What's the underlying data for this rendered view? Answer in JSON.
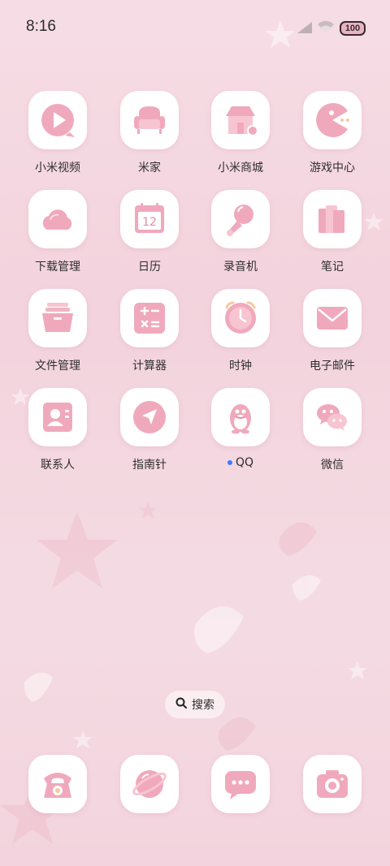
{
  "status_bar": {
    "time": "8:16",
    "battery": "100"
  },
  "apps": [
    {
      "label": "小米视频",
      "icon": "video-play-icon"
    },
    {
      "label": "米家",
      "icon": "sofa-icon"
    },
    {
      "label": "小米商城",
      "icon": "store-icon"
    },
    {
      "label": "游戏中心",
      "icon": "pacman-icon"
    },
    {
      "label": "下载管理",
      "icon": "cloud-icon"
    },
    {
      "label": "日历",
      "icon": "calendar-icon",
      "calendar_day": "12"
    },
    {
      "label": "录音机",
      "icon": "microphone-icon"
    },
    {
      "label": "笔记",
      "icon": "notebook-icon"
    },
    {
      "label": "文件管理",
      "icon": "folder-icon"
    },
    {
      "label": "计算器",
      "icon": "calculator-icon"
    },
    {
      "label": "时钟",
      "icon": "clock-icon"
    },
    {
      "label": "电子邮件",
      "icon": "envelope-icon"
    },
    {
      "label": "联系人",
      "icon": "contact-card-icon"
    },
    {
      "label": "指南针",
      "icon": "compass-icon"
    },
    {
      "label": "QQ",
      "icon": "penguin-icon",
      "new_indicator": true
    },
    {
      "label": "微信",
      "icon": "wechat-bubble-icon"
    }
  ],
  "search": {
    "label": "搜索"
  },
  "dock": [
    {
      "icon": "telephone-icon"
    },
    {
      "icon": "browser-planet-icon"
    },
    {
      "icon": "message-bubble-icon"
    },
    {
      "icon": "camera-icon"
    }
  ],
  "colors": {
    "accent_pink": "#f0a9bc",
    "light_pink": "#f9d3dd",
    "indicator_blue": "#3f7bff"
  }
}
